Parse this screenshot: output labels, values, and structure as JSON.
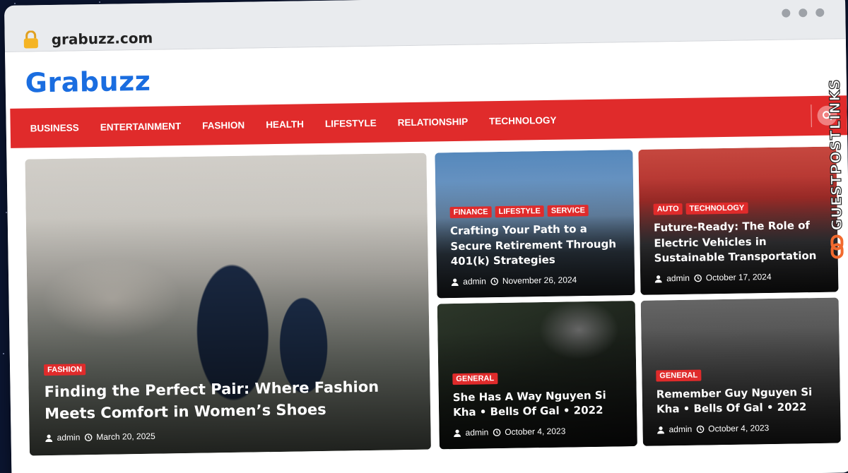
{
  "browser": {
    "url": "grabuzz.com"
  },
  "site": {
    "logo": "Grabuzz",
    "nav": [
      {
        "label": "BUSINESS"
      },
      {
        "label": "ENTERTAINMENT"
      },
      {
        "label": "FASHION"
      },
      {
        "label": "HEALTH"
      },
      {
        "label": "LIFESTYLE"
      },
      {
        "label": "RELATIONSHIP"
      },
      {
        "label": "TECHNOLOGY"
      }
    ]
  },
  "posts": [
    {
      "tags": [
        "FASHION"
      ],
      "title": "Finding the Perfect Pair: Where Fashion Meets Comfort in Women’s Shoes",
      "author": "admin",
      "date": "March 20, 2025"
    },
    {
      "tags": [
        "FINANCE",
        "LIFESTYLE",
        "SERVICE"
      ],
      "title": "Crafting Your Path to a Secure Retirement Through 401(k) Strategies",
      "author": "admin",
      "date": "November 26, 2024"
    },
    {
      "tags": [
        "AUTO",
        "TECHNOLOGY"
      ],
      "title": "Future-Ready: The Role of Electric Vehicles in Sustainable Transportation",
      "author": "admin",
      "date": "October 17, 2024"
    },
    {
      "tags": [
        "GENERAL"
      ],
      "title": "She Has A Way Nguyen Si Kha • Bells Of Gal • 2022",
      "author": "admin",
      "date": "October 4, 2023"
    },
    {
      "tags": [
        "GENERAL"
      ],
      "title": "Remember Guy Nguyen Si Kha • Bells Of Gal • 2022",
      "author": "admin",
      "date": "October 4, 2023"
    }
  ],
  "watermark": {
    "text": "GUESTPOSTLINKS"
  },
  "colors": {
    "brand_blue": "#1a6de0",
    "nav_red": "#e02b2b",
    "tag_red": "#e02b2b"
  },
  "icons": [
    "lock-icon",
    "search-icon",
    "user-icon",
    "clock-icon",
    "link-icon"
  ]
}
